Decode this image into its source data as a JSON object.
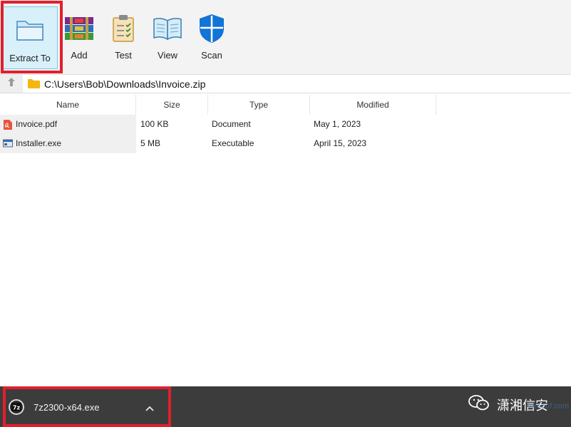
{
  "toolbar": {
    "buttons": [
      {
        "label": "Extract To",
        "icon": "folder-icon",
        "active": true
      },
      {
        "label": "Add",
        "icon": "archive-books-icon"
      },
      {
        "label": "Test",
        "icon": "clipboard-check-icon"
      },
      {
        "label": "View",
        "icon": "open-book-icon"
      },
      {
        "label": "Scan",
        "icon": "shield-icon"
      }
    ]
  },
  "address": {
    "path": "C:\\Users\\Bob\\Downloads\\Invoice.zip"
  },
  "table": {
    "columns": [
      "Name",
      "Size",
      "Type",
      "Modified"
    ],
    "rows": [
      {
        "name": "Invoice.pdf",
        "size": "100 KB",
        "type": "Document",
        "modified": "May 1, 2023",
        "icon": "pdf-file-icon"
      },
      {
        "name": "Installer.exe",
        "size": "5 MB",
        "type": "Executable",
        "modified": "April 15, 2023",
        "icon": "exe-file-icon"
      }
    ]
  },
  "downloads": {
    "file": "7z2300-x64.exe",
    "icon_text": "7z"
  },
  "watermark": {
    "text": "潇湘信安",
    "faint": "freebuf.com"
  },
  "colors": {
    "highlight": "#e1202d",
    "active_bg": "#d8f0fa",
    "download_bar": "#3c3c3c"
  }
}
